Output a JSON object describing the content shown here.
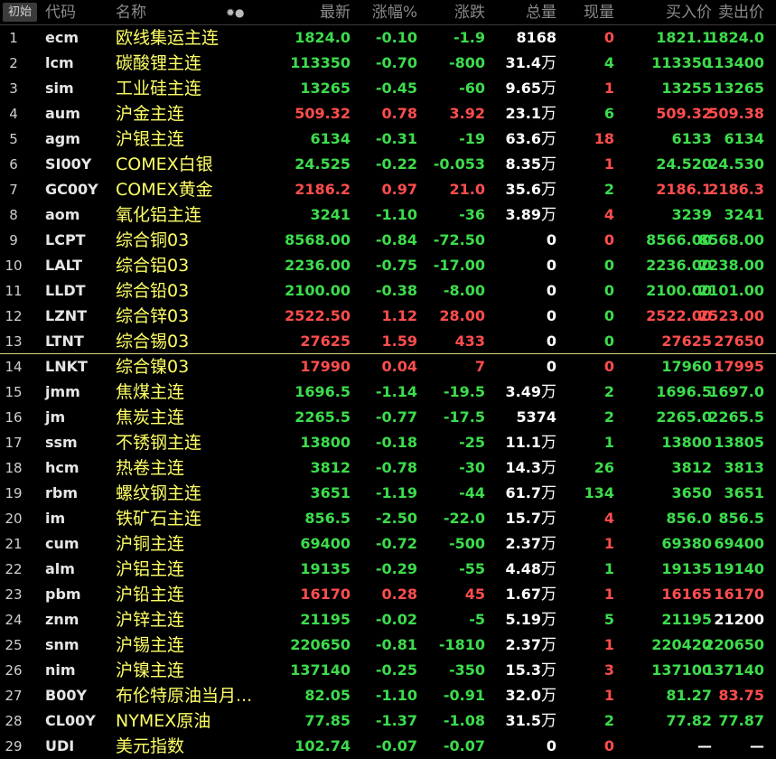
{
  "header": {
    "init_button": "初始",
    "col_code": "代码",
    "col_name": "名称",
    "col_last": "最新",
    "col_pct": "涨幅%",
    "col_change": "涨跌",
    "col_volume": "总量",
    "col_current": "现量",
    "col_bid": "买入价",
    "col_ask": "卖出价",
    "settings_icon": "gear-dot-icon"
  },
  "colors": {
    "up": "#ff4d4d",
    "down": "#3ddc4c",
    "name": "#ffff66"
  },
  "rows": [
    {
      "i": "1",
      "code": "ecm",
      "name": "欧线集运主连",
      "last": "1824.0",
      "pct": "-0.10",
      "chg": "-1.9",
      "vol": "8168",
      "wan": "",
      "cur": "0",
      "bid": "1821.1",
      "ask": "1824.0",
      "t": "down",
      "tc": "red",
      "ta": "down",
      "tb": "down"
    },
    {
      "i": "2",
      "code": "lcm",
      "name": "碳酸锂主连",
      "last": "113350",
      "pct": "-0.70",
      "chg": "-800",
      "vol": "31.4",
      "wan": "万",
      "cur": "4",
      "bid": "113350",
      "ask": "113400",
      "t": "down",
      "tc": "green",
      "ta": "down",
      "tb": "down"
    },
    {
      "i": "3",
      "code": "sim",
      "name": "工业硅主连",
      "last": "13265",
      "pct": "-0.45",
      "chg": "-60",
      "vol": "9.65",
      "wan": "万",
      "cur": "1",
      "bid": "13255",
      "ask": "13265",
      "t": "down",
      "tc": "red",
      "ta": "down",
      "tb": "down"
    },
    {
      "i": "4",
      "code": "aum",
      "name": "沪金主连",
      "last": "509.32",
      "pct": "0.78",
      "chg": "3.92",
      "vol": "23.1",
      "wan": "万",
      "cur": "6",
      "bid": "509.32",
      "ask": "509.38",
      "t": "up",
      "tc": "green",
      "ta": "up",
      "tb": "up"
    },
    {
      "i": "5",
      "code": "agm",
      "name": "沪银主连",
      "last": "6134",
      "pct": "-0.31",
      "chg": "-19",
      "vol": "63.6",
      "wan": "万",
      "cur": "18",
      "bid": "6133",
      "ask": "6134",
      "t": "down",
      "tc": "red",
      "ta": "down",
      "tb": "down"
    },
    {
      "i": "6",
      "code": "SI00Y",
      "name": "COMEX白银",
      "last": "24.525",
      "pct": "-0.22",
      "chg": "-0.053",
      "vol": "8.35",
      "wan": "万",
      "cur": "1",
      "bid": "24.520",
      "ask": "24.530",
      "t": "down",
      "tc": "red",
      "ta": "down",
      "tb": "down"
    },
    {
      "i": "7",
      "code": "GC00Y",
      "name": "COMEX黄金",
      "last": "2186.2",
      "pct": "0.97",
      "chg": "21.0",
      "vol": "35.6",
      "wan": "万",
      "cur": "2",
      "bid": "2186.1",
      "ask": "2186.3",
      "t": "up",
      "tc": "green",
      "ta": "up",
      "tb": "up"
    },
    {
      "i": "8",
      "code": "aom",
      "name": "氧化铝主连",
      "last": "3241",
      "pct": "-1.10",
      "chg": "-36",
      "vol": "3.89",
      "wan": "万",
      "cur": "4",
      "bid": "3239",
      "ask": "3241",
      "t": "down",
      "tc": "red",
      "ta": "down",
      "tb": "down"
    },
    {
      "i": "9",
      "code": "LCPT",
      "name": "综合铜03",
      "last": "8568.00",
      "pct": "-0.84",
      "chg": "-72.50",
      "vol": "0",
      "wan": "",
      "cur": "0",
      "bid": "8566.00",
      "ask": "8568.00",
      "t": "down",
      "tc": "red",
      "ta": "down",
      "tb": "down"
    },
    {
      "i": "10",
      "code": "LALT",
      "name": "综合铝03",
      "last": "2236.00",
      "pct": "-0.75",
      "chg": "-17.00",
      "vol": "0",
      "wan": "",
      "cur": "0",
      "bid": "2236.00",
      "ask": "2238.00",
      "t": "down",
      "tc": "green",
      "ta": "down",
      "tb": "down"
    },
    {
      "i": "11",
      "code": "LLDT",
      "name": "综合铅03",
      "last": "2100.00",
      "pct": "-0.38",
      "chg": "-8.00",
      "vol": "0",
      "wan": "",
      "cur": "0",
      "bid": "2100.00",
      "ask": "2101.00",
      "t": "down",
      "tc": "green",
      "ta": "down",
      "tb": "down"
    },
    {
      "i": "12",
      "code": "LZNT",
      "name": "综合锌03",
      "last": "2522.50",
      "pct": "1.12",
      "chg": "28.00",
      "vol": "0",
      "wan": "",
      "cur": "0",
      "bid": "2522.00",
      "ask": "2523.00",
      "t": "up",
      "tc": "green",
      "ta": "up",
      "tb": "up"
    },
    {
      "i": "13",
      "code": "LTNT",
      "name": "综合锡03",
      "last": "27625",
      "pct": "1.59",
      "chg": "433",
      "vol": "0",
      "wan": "",
      "cur": "0",
      "bid": "27625",
      "ask": "27650",
      "t": "up",
      "tc": "green",
      "ta": "up",
      "tb": "up"
    },
    {
      "i": "14",
      "code": "LNKT",
      "name": "综合镍03",
      "last": "17990",
      "pct": "0.04",
      "chg": "7",
      "vol": "0",
      "wan": "",
      "cur": "0",
      "bid": "17960",
      "ask": "17995",
      "t": "up",
      "tc": "red",
      "ta": "down",
      "tb": "up"
    },
    {
      "i": "15",
      "code": "jmm",
      "name": "焦煤主连",
      "last": "1696.5",
      "pct": "-1.14",
      "chg": "-19.5",
      "vol": "3.49",
      "wan": "万",
      "cur": "2",
      "bid": "1696.5",
      "ask": "1697.0",
      "t": "down",
      "tc": "green",
      "ta": "down",
      "tb": "down"
    },
    {
      "i": "16",
      "code": "jm",
      "name": "焦炭主连",
      "last": "2265.5",
      "pct": "-0.77",
      "chg": "-17.5",
      "vol": "5374",
      "wan": "",
      "cur": "2",
      "bid": "2265.0",
      "ask": "2265.5",
      "t": "down",
      "tc": "green",
      "ta": "down",
      "tb": "down"
    },
    {
      "i": "17",
      "code": "ssm",
      "name": "不锈钢主连",
      "last": "13800",
      "pct": "-0.18",
      "chg": "-25",
      "vol": "11.1",
      "wan": "万",
      "cur": "1",
      "bid": "13800",
      "ask": "13805",
      "t": "down",
      "tc": "green",
      "ta": "down",
      "tb": "down"
    },
    {
      "i": "18",
      "code": "hcm",
      "name": "热卷主连",
      "last": "3812",
      "pct": "-0.78",
      "chg": "-30",
      "vol": "14.3",
      "wan": "万",
      "cur": "26",
      "bid": "3812",
      "ask": "3813",
      "t": "down",
      "tc": "green",
      "ta": "down",
      "tb": "down"
    },
    {
      "i": "19",
      "code": "rbm",
      "name": "螺纹钢主连",
      "last": "3651",
      "pct": "-1.19",
      "chg": "-44",
      "vol": "61.7",
      "wan": "万",
      "cur": "134",
      "bid": "3650",
      "ask": "3651",
      "t": "down",
      "tc": "green",
      "ta": "down",
      "tb": "down"
    },
    {
      "i": "20",
      "code": "im",
      "name": "铁矿石主连",
      "last": "856.5",
      "pct": "-2.50",
      "chg": "-22.0",
      "vol": "15.7",
      "wan": "万",
      "cur": "4",
      "bid": "856.0",
      "ask": "856.5",
      "t": "down",
      "tc": "red",
      "ta": "down",
      "tb": "down"
    },
    {
      "i": "21",
      "code": "cum",
      "name": "沪铜主连",
      "last": "69400",
      "pct": "-0.72",
      "chg": "-500",
      "vol": "2.37",
      "wan": "万",
      "cur": "1",
      "bid": "69380",
      "ask": "69400",
      "t": "down",
      "tc": "red",
      "ta": "down",
      "tb": "down"
    },
    {
      "i": "22",
      "code": "alm",
      "name": "沪铝主连",
      "last": "19135",
      "pct": "-0.29",
      "chg": "-55",
      "vol": "4.48",
      "wan": "万",
      "cur": "1",
      "bid": "19135",
      "ask": "19140",
      "t": "down",
      "tc": "green",
      "ta": "down",
      "tb": "down"
    },
    {
      "i": "23",
      "code": "pbm",
      "name": "沪铅主连",
      "last": "16170",
      "pct": "0.28",
      "chg": "45",
      "vol": "1.67",
      "wan": "万",
      "cur": "1",
      "bid": "16165",
      "ask": "16170",
      "t": "up",
      "tc": "red",
      "ta": "up",
      "tb": "up"
    },
    {
      "i": "24",
      "code": "znm",
      "name": "沪锌主连",
      "last": "21195",
      "pct": "-0.02",
      "chg": "-5",
      "vol": "5.19",
      "wan": "万",
      "cur": "5",
      "bid": "21195",
      "ask": "21200",
      "t": "down",
      "tc": "green",
      "ta": "down",
      "tb": "flat"
    },
    {
      "i": "25",
      "code": "snm",
      "name": "沪锡主连",
      "last": "220650",
      "pct": "-0.81",
      "chg": "-1810",
      "vol": "2.37",
      "wan": "万",
      "cur": "1",
      "bid": "220420",
      "ask": "220650",
      "t": "down",
      "tc": "red",
      "ta": "down",
      "tb": "down"
    },
    {
      "i": "26",
      "code": "nim",
      "name": "沪镍主连",
      "last": "137140",
      "pct": "-0.25",
      "chg": "-350",
      "vol": "15.3",
      "wan": "万",
      "cur": "3",
      "bid": "137100",
      "ask": "137140",
      "t": "down",
      "tc": "red",
      "ta": "down",
      "tb": "down"
    },
    {
      "i": "27",
      "code": "B00Y",
      "name": "布伦特原油当月...",
      "last": "82.05",
      "pct": "-1.10",
      "chg": "-0.91",
      "vol": "32.0",
      "wan": "万",
      "cur": "1",
      "bid": "81.27",
      "ask": "83.75",
      "t": "down",
      "tc": "red",
      "ta": "down",
      "tb": "up"
    },
    {
      "i": "28",
      "code": "CL00Y",
      "name": "NYMEX原油",
      "last": "77.85",
      "pct": "-1.37",
      "chg": "-1.08",
      "vol": "31.5",
      "wan": "万",
      "cur": "2",
      "bid": "77.82",
      "ask": "77.87",
      "t": "down",
      "tc": "green",
      "ta": "down",
      "tb": "down"
    },
    {
      "i": "29",
      "code": "UDI",
      "name": "美元指数",
      "last": "102.74",
      "pct": "-0.07",
      "chg": "-0.07",
      "vol": "0",
      "wan": "",
      "cur": "0",
      "bid": "—",
      "ask": "—",
      "t": "down",
      "tc": "red",
      "ta": "flat",
      "tb": "flat"
    }
  ]
}
